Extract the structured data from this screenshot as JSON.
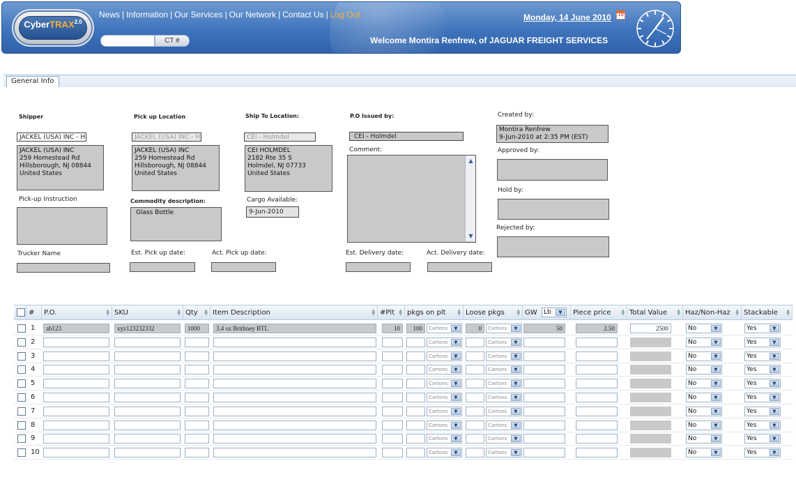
{
  "header": {
    "logo_text": "CyberTRAX",
    "logo_version": "2.0",
    "nav": [
      "News",
      "Information",
      "Our Services",
      "Our Network",
      "Contact Us"
    ],
    "logout": "Log Out",
    "ct_label": "CT #",
    "date": "Monday, 14 June 2010",
    "calendar_day": "18",
    "welcome": "Welcome Montira Renfrew, of JAGUAR FREIGHT SERVICES"
  },
  "tab": {
    "label": "General Info"
  },
  "form": {
    "shipper": {
      "label": "Shipper",
      "select": "JACKEL (USA) INC - Hills",
      "address": [
        "JACKEL (USA) INC",
        "259 Homestead Rd",
        "Hillsborough, NJ 08844",
        "United States"
      ]
    },
    "pickup_location": {
      "label": "Pick up Location",
      "select": "JACKEL (USA) INC - Hills",
      "address": [
        "JACKEL (USA) INC",
        "259 Homestead Rd",
        "Hillsborough, NJ 08844",
        "United States"
      ]
    },
    "ship_to": {
      "label": "Ship To Location:",
      "select": "CEI - Holmdel",
      "address": [
        "CEI HOLMDEL",
        "2182 Rte 35 S",
        "Holmdel, NJ 07733",
        "United States"
      ]
    },
    "po_issued": {
      "label": "P.O Issued by:",
      "value": "CEI - Holmdel"
    },
    "comment_label": "Comment:",
    "created_by": {
      "label": "Created by:",
      "line1": "Montira Renfrew",
      "line2": "9-Jun-2010 at 2:35 PM (EST)"
    },
    "approved_by_label": "Approved by:",
    "hold_by_label": "Hold by:",
    "rejected_by_label": "Rejected by:",
    "pickup_instruction_label": "Pick-up Instruction",
    "commodity": {
      "label": "Commodity description:",
      "value": "Glass Bottle"
    },
    "cargo_available": {
      "label": "Cargo Available:",
      "value": "9-Jun-2010"
    },
    "trucker_label": "Trucker Name",
    "est_pickup_label": "Est. Pick up date:",
    "act_pickup_label": "Act. Pick up date:",
    "est_delivery_label": "Est. Delivery date:",
    "act_delivery_label": "Act. Delivery date:"
  },
  "grid": {
    "headers": {
      "num": "#",
      "po": "P.O.",
      "sku": "SKU",
      "qty": "Qty",
      "desc": "Item Description",
      "plt": "#Plt",
      "pkgs": "pkgs on plt",
      "loose": "Loose pkgs",
      "gw": "GW",
      "gw_unit": "Lb",
      "price": "Piece price",
      "total": "Total Value",
      "haz": "Haz/Non-Haz",
      "stack": "Stackable"
    },
    "carton_option": "Cartons",
    "rows": [
      {
        "n": "1",
        "po": "ab123",
        "sku": "xyz123232332",
        "qty": "1000",
        "desc": "3.4 oz Brithney BTL",
        "plt": "10",
        "pkgs": "100",
        "loose": "0",
        "gw": "50",
        "price": "2.50",
        "total": "2500",
        "haz": "No",
        "stack": "Yes"
      },
      {
        "n": "2",
        "haz": "No",
        "stack": "Yes"
      },
      {
        "n": "3",
        "haz": "No",
        "stack": "Yes"
      },
      {
        "n": "4",
        "haz": "No",
        "stack": "Yes"
      },
      {
        "n": "5",
        "haz": "No",
        "stack": "Yes"
      },
      {
        "n": "6",
        "haz": "No",
        "stack": "Yes"
      },
      {
        "n": "7",
        "haz": "No",
        "stack": "Yes"
      },
      {
        "n": "8",
        "haz": "No",
        "stack": "Yes"
      },
      {
        "n": "9",
        "haz": "No",
        "stack": "Yes"
      },
      {
        "n": "10",
        "haz": "No",
        "stack": "Yes"
      }
    ]
  }
}
